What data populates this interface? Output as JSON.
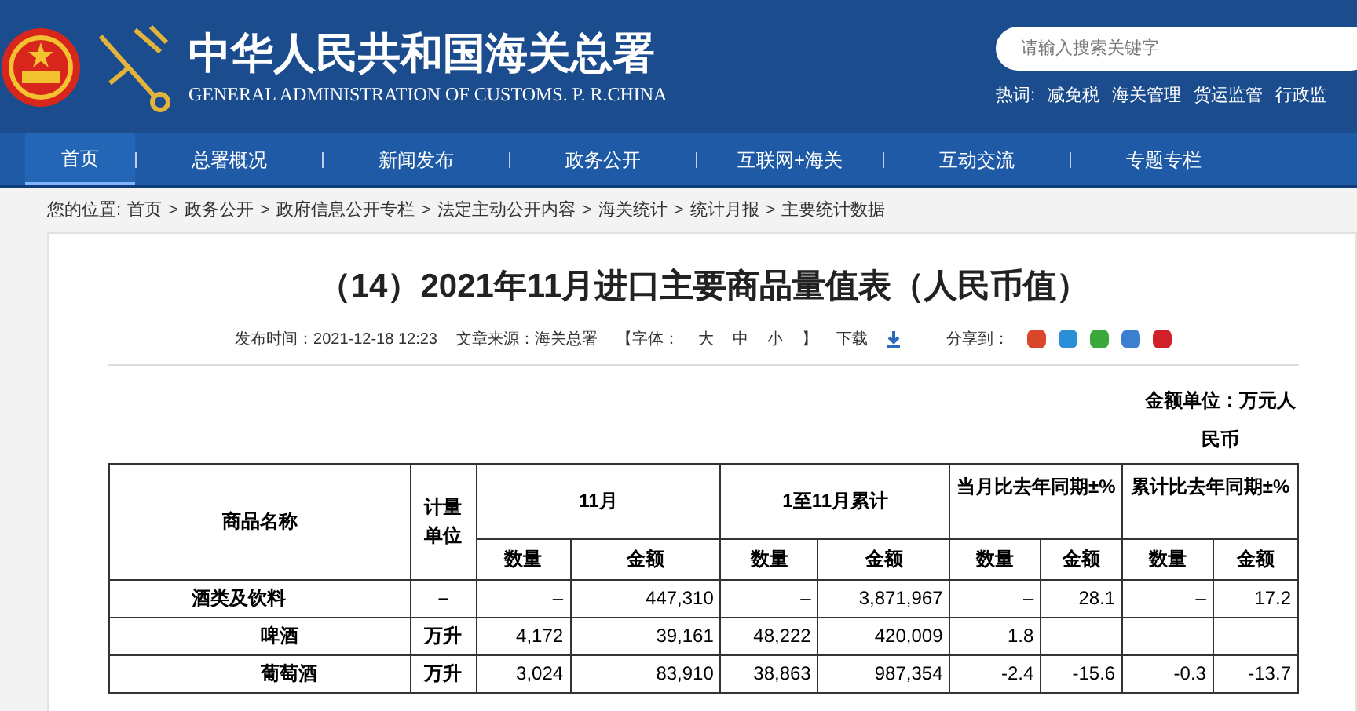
{
  "header": {
    "title": "中华人民共和国海关总署",
    "subtitle": "GENERAL ADMINISTRATION OF CUSTOMS. P. R.CHINA",
    "search": {
      "placeholder": "请输入搜索关键字"
    },
    "hot_label": "热词:",
    "hot_words": [
      "减免税",
      "海关管理",
      "货运监管",
      "行政监"
    ]
  },
  "nav": [
    {
      "label": "首页",
      "selected": true
    },
    {
      "label": "总署概况",
      "selected": false
    },
    {
      "label": "新闻发布",
      "selected": false
    },
    {
      "label": "政务公开",
      "selected": false
    },
    {
      "label": "互联网+海关",
      "selected": false
    },
    {
      "label": "互动交流",
      "selected": false
    },
    {
      "label": "专题专栏",
      "selected": false
    }
  ],
  "breadcrumb": {
    "label": "您的位置:",
    "separator": ">",
    "items": [
      "首页",
      "政务公开",
      "政府信息公开专栏",
      "法定主动公开内容",
      "海关统计",
      "统计月报",
      "主要统计数据"
    ]
  },
  "article": {
    "title": "（14）2021年11月进口主要商品量值表（人民币值）",
    "published": "发布时间：2021-12-18 12:23",
    "source": "文章来源：海关总署",
    "font_label": "【字体：",
    "font_sizes": [
      "大",
      "中",
      "小"
    ],
    "font_end": "】",
    "download": "下载",
    "share": "分享到："
  },
  "unit_note": "金额单位：万元人民币",
  "table": {
    "header_rows": [
      [
        {
          "label": "商品名称",
          "rowspan": 2
        },
        {
          "label": "计量单位",
          "rowspan": 2
        },
        {
          "label": "11月",
          "colspan": 2
        },
        {
          "label": "1至11月累计",
          "colspan": 2
        },
        {
          "label": "当月比去年同期±%",
          "colspan": 2
        },
        {
          "label": "累计比去年同期±%",
          "colspan": 2
        }
      ],
      [
        {
          "label": "数量"
        },
        {
          "label": "金额"
        },
        {
          "label": "数量"
        },
        {
          "label": "金额"
        },
        {
          "label": "数量"
        },
        {
          "label": "金额"
        },
        {
          "label": "数量"
        },
        {
          "label": "金额"
        }
      ]
    ],
    "rows": [
      {
        "kind": "category",
        "cells": [
          "酒类及饮料",
          "–",
          "–",
          "447,310",
          "–",
          "3,871,967",
          "–",
          "28.1",
          "–",
          "17.2"
        ]
      },
      {
        "kind": "item",
        "cells": [
          "啤酒",
          "万升",
          "4,172",
          "39,161",
          "48,222",
          "420,009",
          "1.8",
          "",
          "",
          ""
        ]
      },
      {
        "kind": "item",
        "cells": [
          "葡萄酒",
          "万升",
          "3,024",
          "83,910",
          "38,863",
          "987,354",
          "-2.4",
          "-15.6",
          "-0.3",
          "-13.7"
        ]
      }
    ]
  }
}
